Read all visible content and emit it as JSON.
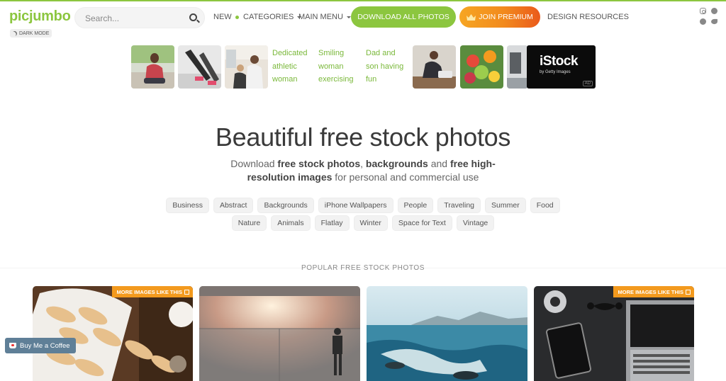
{
  "header": {
    "logo": "picjumbo",
    "dark_mode_label": "DARK MODE",
    "search_placeholder": "Search...",
    "nav": {
      "new": "NEW",
      "categories": "CATEGORIES",
      "main_menu": "MAIN MENU"
    },
    "download_all": "DOWNLOAD ALL PHOTOS",
    "join_premium": "JOIN PREMIUM",
    "design_resources": "DESIGN RESOURCES",
    "social_icons": [
      "instagram-icon",
      "facebook-icon",
      "pinterest-icon",
      "twitter-icon"
    ]
  },
  "ad": {
    "captions": [
      "Dedicated athletic woman",
      "Smiling woman exercising at home",
      "Dad and son having fun outdoors."
    ],
    "istock_brand": "iStock",
    "istock_sub": "by Getty Images",
    "ad_label": "AD"
  },
  "hero": {
    "title": "Beautiful free stock photos",
    "sub_1": "Download ",
    "sub_b1": "free stock photos",
    "sub_2": ", ",
    "sub_b2": "backgrounds",
    "sub_3": " and ",
    "sub_b3": "free high-resolution images",
    "sub_4": " for personal and commercial use"
  },
  "tags_row1": [
    "Business",
    "Abstract",
    "Backgrounds",
    "iPhone Wallpapers",
    "People",
    "Traveling",
    "Summer",
    "Food"
  ],
  "tags_row2": [
    "Nature",
    "Animals",
    "Flatlay",
    "Winter",
    "Space for Text",
    "Vintage"
  ],
  "popular": {
    "title": "POPULAR FREE STOCK PHOTOS",
    "badge": "MORE IMAGES LIKE THIS"
  },
  "coffee_label": "Buy Me a Coffee",
  "colors": {
    "brand_green": "#8cc63f",
    "premium_orange": "#f28a1d",
    "badge_orange": "#f39a1e",
    "coffee_blue": "#5f7f97"
  }
}
